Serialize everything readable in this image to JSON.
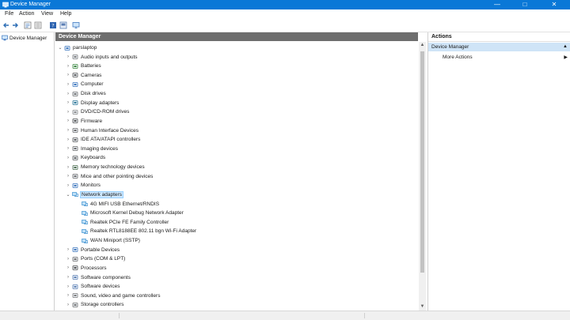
{
  "window": {
    "title": "Device Manager",
    "minimize_glyph": "—",
    "maximize_glyph": "□",
    "close_glyph": "✕"
  },
  "menu": [
    "File",
    "Action",
    "View",
    "Help"
  ],
  "toolbar_icons": [
    "back-icon",
    "forward-icon",
    "properties-icon",
    "list-icon",
    "help-icon",
    "view-icon",
    "monitor-icon"
  ],
  "left_pane": {
    "item_label": "Device Manager"
  },
  "center_pane": {
    "header": "Device Manager"
  },
  "tree": [
    {
      "label": "parslaptop",
      "expanded": true,
      "icon": "computer-icon"
    },
    {
      "label": "Audio inputs and outputs",
      "icon": "speaker-icon"
    },
    {
      "label": "Batteries",
      "icon": "battery-icon"
    },
    {
      "label": "Cameras",
      "icon": "camera-icon"
    },
    {
      "label": "Computer",
      "icon": "monitor-icon"
    },
    {
      "label": "Disk drives",
      "icon": "disk-icon"
    },
    {
      "label": "Display adapters",
      "icon": "display-icon"
    },
    {
      "label": "DVD/CD-ROM drives",
      "icon": "dvd-icon"
    },
    {
      "label": "Firmware",
      "icon": "chip-icon"
    },
    {
      "label": "Human Interface Devices",
      "icon": "hid-icon"
    },
    {
      "label": "IDE ATA/ATAPI controllers",
      "icon": "controller-icon"
    },
    {
      "label": "Imaging devices",
      "icon": "scanner-icon"
    },
    {
      "label": "Keyboards",
      "icon": "keyboard-icon"
    },
    {
      "label": "Memory technology devices",
      "icon": "memory-icon"
    },
    {
      "label": "Mice and other pointing devices",
      "icon": "mouse-icon"
    },
    {
      "label": "Monitors",
      "icon": "monitor-icon"
    },
    {
      "label": "Network adapters",
      "expanded": true,
      "selected": true,
      "icon": "network-icon"
    },
    {
      "label": "4G MIFI USB Ethernet/RNDIS",
      "child": true,
      "icon": "network-icon"
    },
    {
      "label": "Microsoft Kernel Debug Network Adapter",
      "child": true,
      "icon": "network-icon"
    },
    {
      "label": "Realtek PCIe FE Family Controller",
      "child": true,
      "icon": "network-icon"
    },
    {
      "label": "Realtek RTL8188EE 802.11 bgn Wi-Fi Adapter",
      "child": true,
      "icon": "network-icon"
    },
    {
      "label": "WAN Miniport (SSTP)",
      "child": true,
      "icon": "network-icon"
    },
    {
      "label": "Portable Devices",
      "icon": "portable-icon"
    },
    {
      "label": "Ports (COM & LPT)",
      "icon": "port-icon"
    },
    {
      "label": "Processors",
      "icon": "processor-icon"
    },
    {
      "label": "Software components",
      "icon": "software-icon"
    },
    {
      "label": "Software devices",
      "icon": "software-icon"
    },
    {
      "label": "Sound, video and game controllers",
      "icon": "speaker-icon"
    },
    {
      "label": "Storage controllers",
      "icon": "storage-icon"
    }
  ],
  "actions_pane": {
    "header": "Actions",
    "section": "Device Manager",
    "items": [
      "More Actions"
    ]
  },
  "colors": {
    "titlebar": "#0a78d7",
    "selection": "#cde8ff",
    "actions_section": "#cfe4f7",
    "pane_header": "#6e6e6e"
  }
}
